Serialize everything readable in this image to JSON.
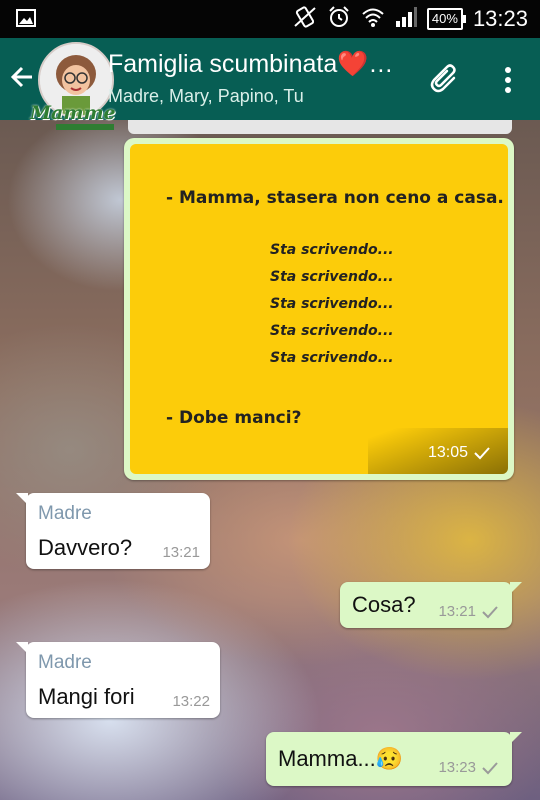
{
  "status_bar": {
    "time": "13:23",
    "battery": "40%"
  },
  "header": {
    "title": "Famiglia scumbinata❤️…",
    "subtitle": "Madre, Mary, Papino, Tu",
    "logo_text": "Mamme",
    "icons": [
      "back-arrow-icon",
      "paperclip-icon",
      "more-vert-icon"
    ],
    "color": "#075e54"
  },
  "messages": [
    {
      "type": "image",
      "direction": "out",
      "image_text": {
        "top": "- Mamma, stasera non ceno a casa.",
        "typing": [
          "Sta scrivendo...",
          "Sta scrivendo...",
          "Sta scrivendo...",
          "Sta scrivendo...",
          "Sta scrivendo..."
        ],
        "bottom": "- Dobe manci?"
      },
      "time": "13:05"
    },
    {
      "type": "text",
      "direction": "in",
      "sender": "Madre",
      "text": "Davvero?",
      "time": "13:21"
    },
    {
      "type": "text",
      "direction": "out",
      "text": "Cosa?",
      "time": "13:21"
    },
    {
      "type": "text",
      "direction": "in",
      "sender": "Madre",
      "text": "Mangi fori",
      "time": "13:22"
    },
    {
      "type": "text",
      "direction": "out",
      "text": "Mamma...😥",
      "time": "13:23"
    }
  ],
  "colors": {
    "outgoing_bubble": "#dcf8c6",
    "incoming_bubble": "#ffffff",
    "meme_background": "#fccc0a"
  }
}
